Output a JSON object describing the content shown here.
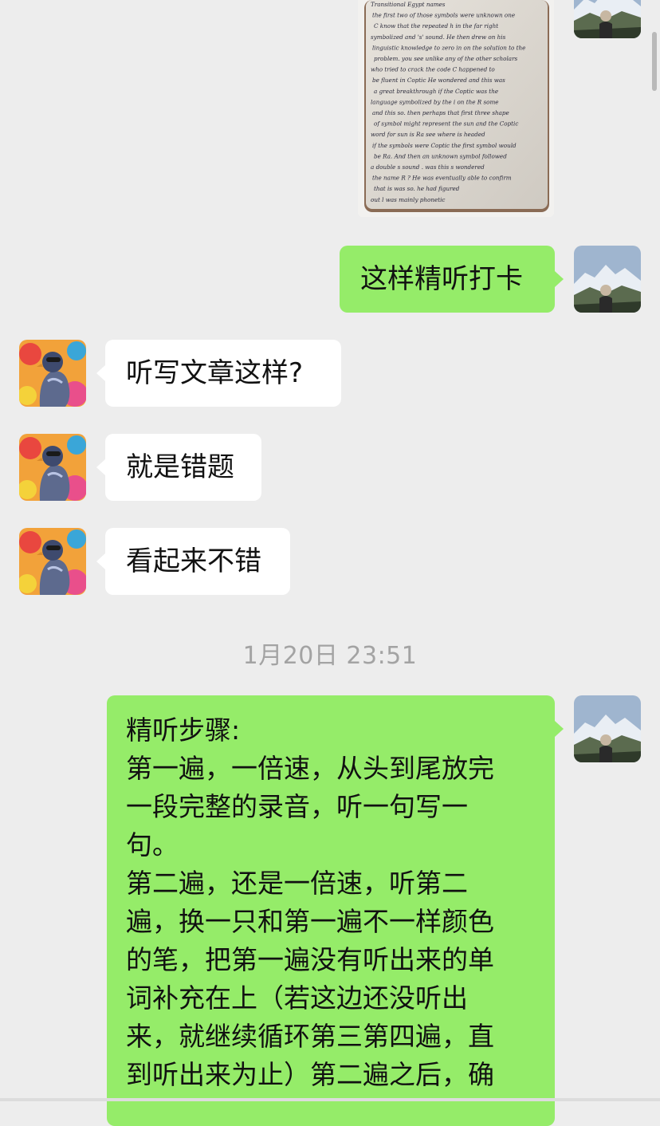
{
  "photo_notes": {
    "line_text": [
      "Transitional  Egypt names",
      "the first two of those symbols were unknown one",
      "C  know that the repeated h  in the far right",
      "symbolized and 's' sound. He then drew on his",
      "linguistic knowledge to zero in on the solution to the",
      "problem. you see unlike any of the other scholars",
      "who  tried to crack the code  C happened to",
      "be  fluent in  Coptic   He wondered and this was",
      "a great breakthrough  if the Coptic  was the",
      "language symbolized by the i  on the R  some",
      "and this so. then perhaps that  first three shape",
      "of symbol  might represent the sun  and the Coptic",
      "word for sun is  Ra    see where  is headed",
      "if the symbols were Coptic   the first symbol would",
      "be Ra.   And then an unknown symbol followed",
      "a double  s  sound . was this  s  wondered",
      "the name  R  ?  He was eventually able to confirm",
      "that is was    so. he had figured",
      "out  l   was mainly phonetic"
    ]
  },
  "messages": [
    {
      "side": "right",
      "text": "这样精听打卡"
    },
    {
      "side": "left",
      "text": "听写文章这样?"
    },
    {
      "side": "left",
      "text": "就是错题"
    },
    {
      "side": "left",
      "text": "看起来不错"
    }
  ],
  "timestamp": "1月20日 23:51",
  "long_message": {
    "lines": [
      "精听步骤:",
      "第一遍，一倍速，从头到尾放完",
      "一段完整的录音，听一句写一",
      "句。",
      "第二遍，还是一倍速，听第二",
      "遍，换一只和第一遍不一样颜色",
      "的笔，把第一遍没有听出来的单",
      "词补充在上（若这边还没听出",
      "来，就继续循环第三第四遍，直",
      "到听出来为止）第二遍之后，确"
    ]
  },
  "colors": {
    "background": "#ededed",
    "incoming_bubble": "#ffffff",
    "outgoing_bubble": "#95ec69",
    "timestamp_text": "#a3a3a3"
  },
  "icons": {
    "self_avatar": "mountain-landscape-avatar",
    "friend_avatar": "colorful-pigeon-avatar"
  }
}
